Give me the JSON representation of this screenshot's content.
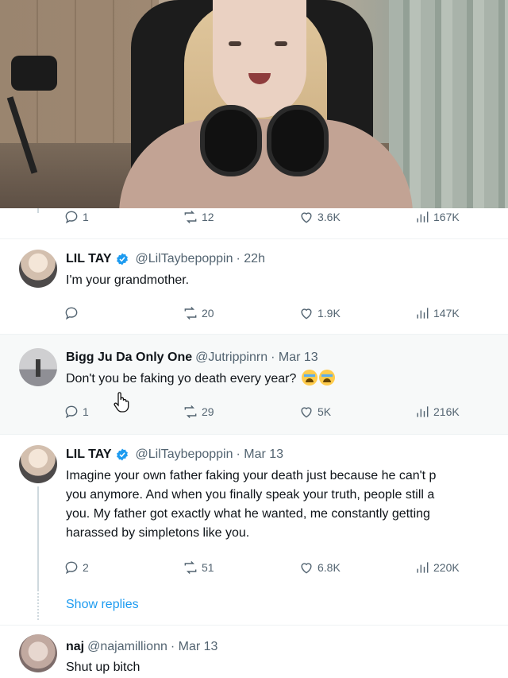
{
  "video": {
    "description_icon": "webcam-video-frame"
  },
  "top_actions": {
    "replies": "1",
    "reposts": "12",
    "likes": "3.6K",
    "views": "167K"
  },
  "tweets": [
    {
      "name": "LIL TAY",
      "verified": true,
      "handle": "@LilTaybepoppin",
      "time": "· 22h",
      "text": [
        "I'm your grandmother."
      ],
      "replies": "",
      "reposts": "20",
      "likes": "1.9K",
      "views": "147K"
    },
    {
      "name": "Bigg Ju Da Only One",
      "verified": false,
      "handle": "@Jutrippinrn",
      "time": "· Mar 13",
      "text": [
        "Don't you be faking yo death every year?"
      ],
      "replies": "1",
      "reposts": "29",
      "likes": "5K",
      "views": "216K"
    },
    {
      "name": "LIL TAY",
      "verified": true,
      "handle": "@LilTaybepoppin",
      "time": "· Mar 13",
      "text": [
        "Imagine your own father faking your death just because he can't p",
        "you anymore. And when you finally speak your truth, people still a",
        "you. My father got exactly what he wanted, me constantly getting",
        "harassed by simpletons like you."
      ],
      "replies": "2",
      "reposts": "51",
      "likes": "6.8K",
      "views": "220K"
    },
    {
      "name": "naj",
      "verified": false,
      "handle": "@najamillionn",
      "time": "· Mar 13",
      "text": [
        "Shut up bitch"
      ]
    }
  ],
  "show_replies_label": "Show replies",
  "colors": {
    "accent": "#1d9bf0",
    "muted": "#536471",
    "text": "#0f1419",
    "highlight": "#f7f9f9"
  },
  "icons": [
    "reply-icon",
    "repost-icon",
    "like-icon",
    "views-icon",
    "verified-badge-icon",
    "crying-emoji-icon",
    "hand-cursor-icon"
  ]
}
